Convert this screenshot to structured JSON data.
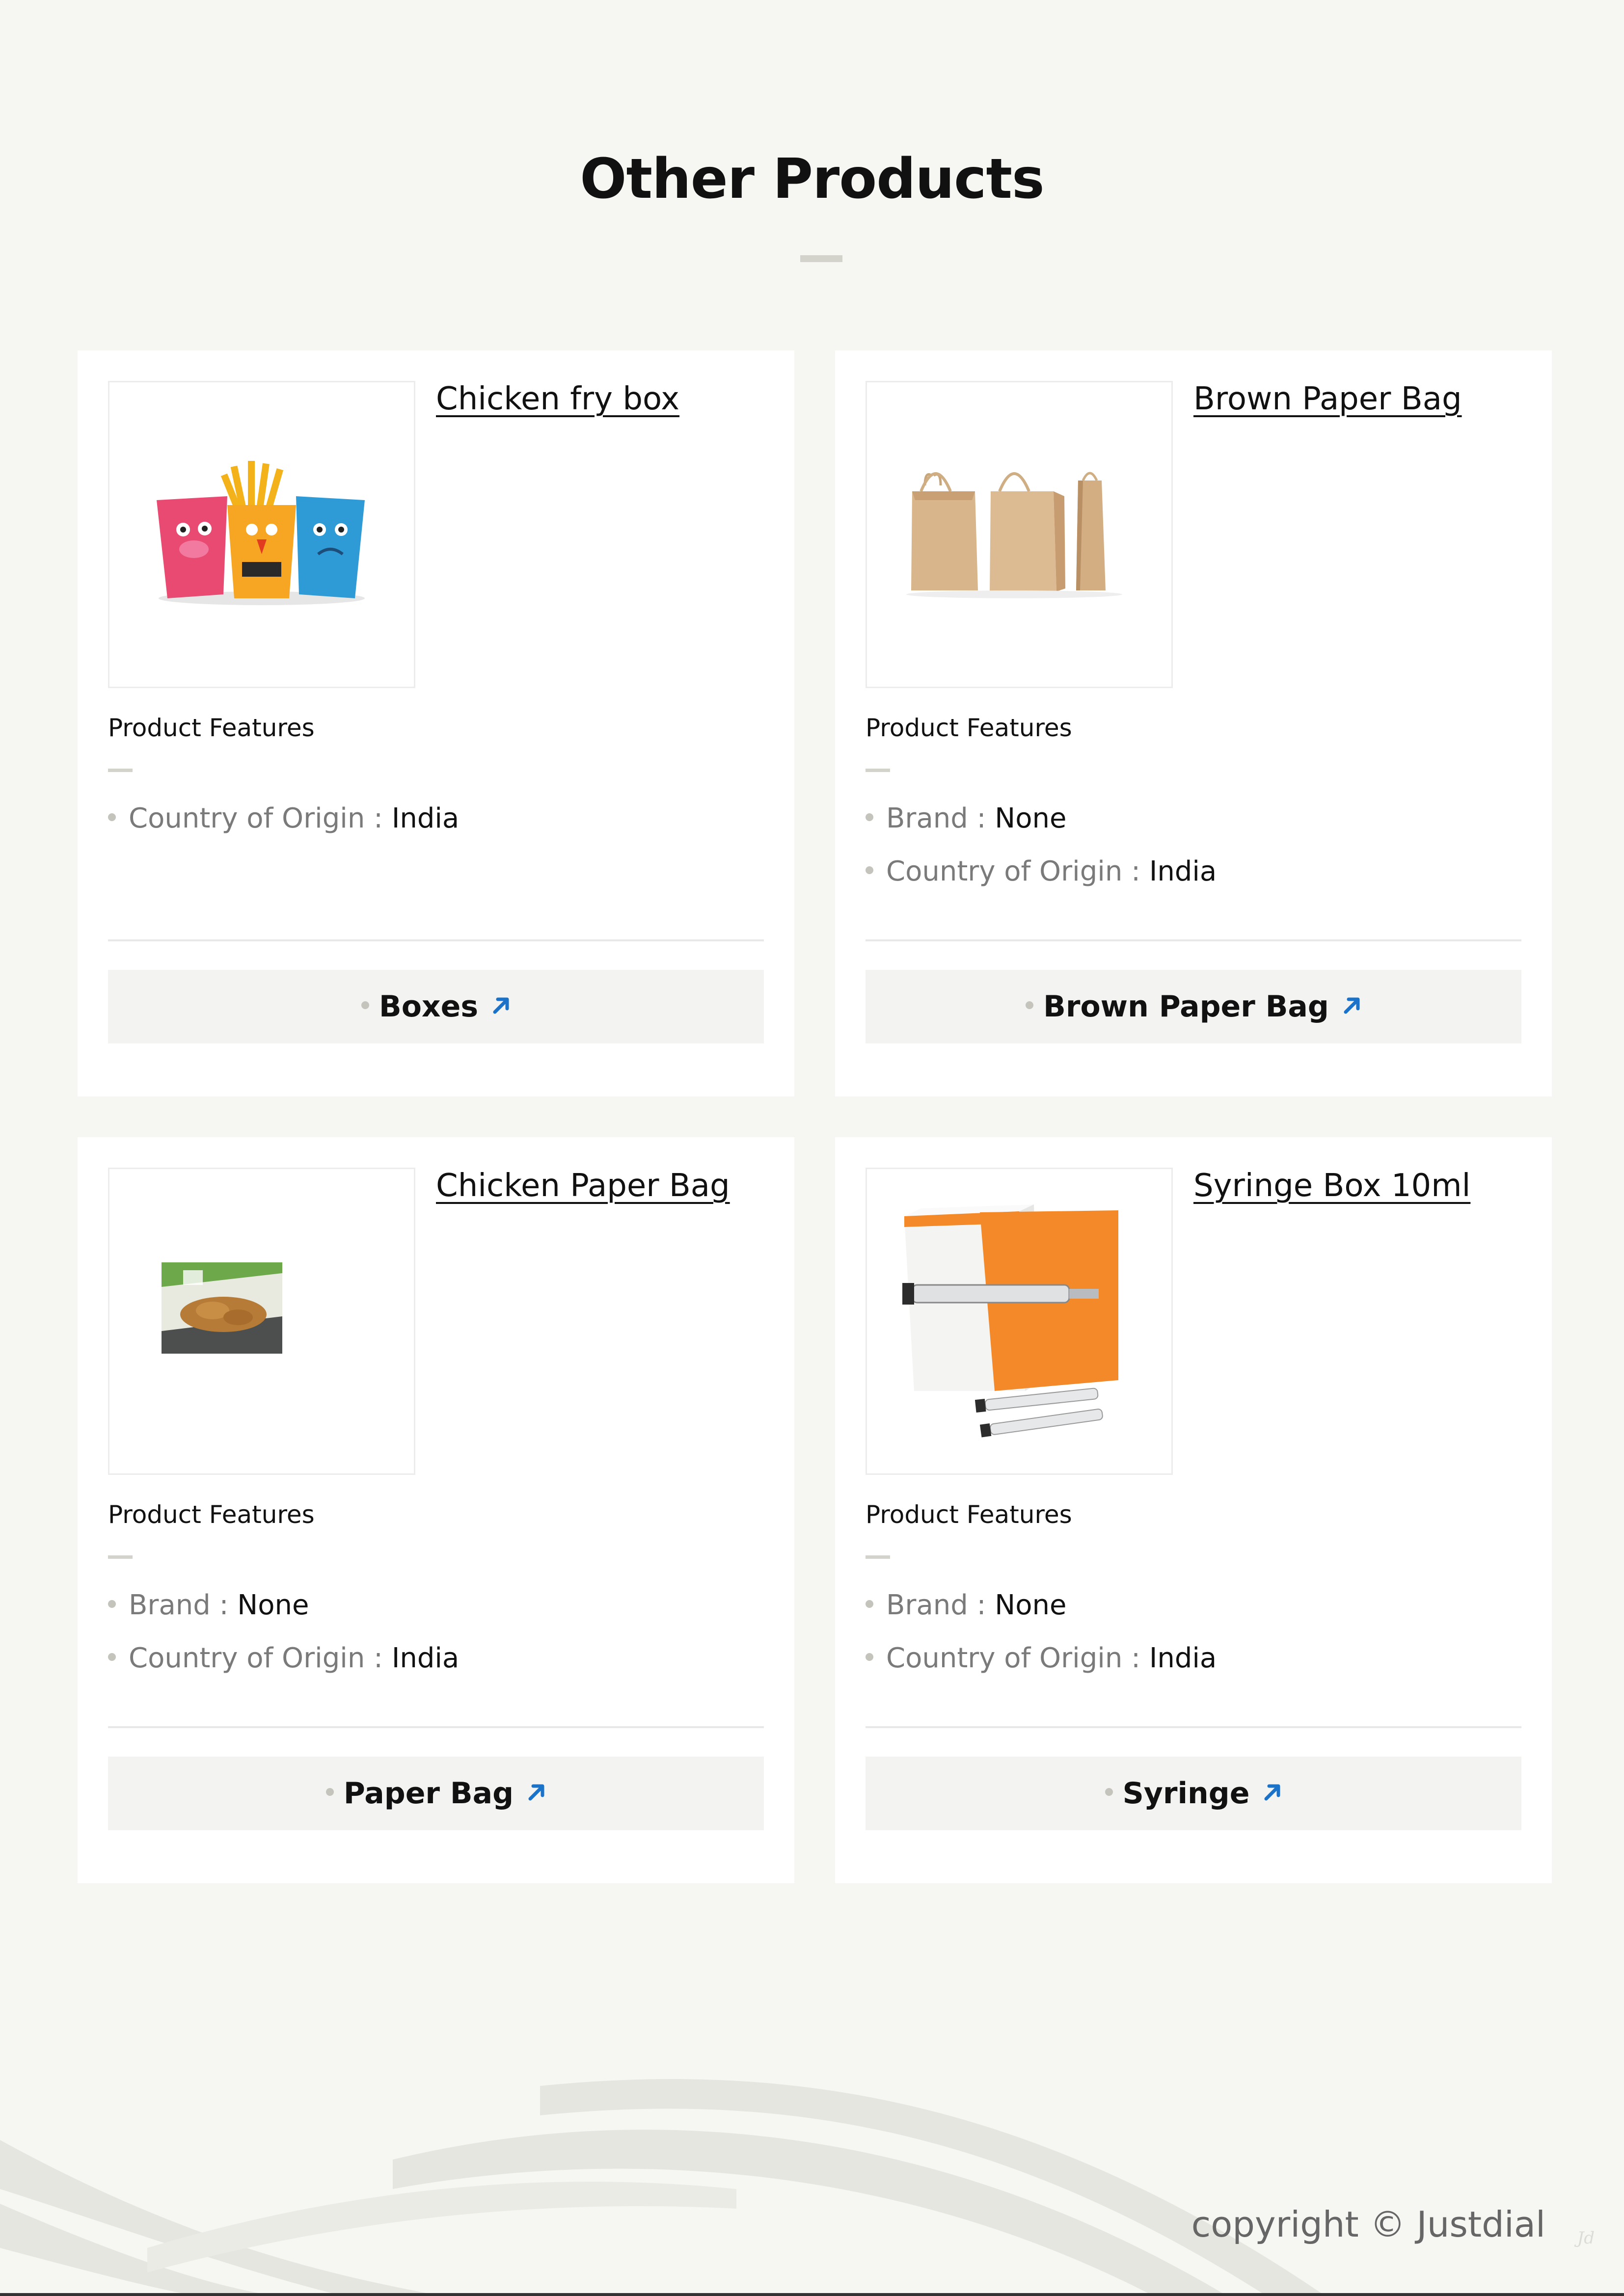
{
  "section": {
    "title": "Other Products"
  },
  "products": [
    {
      "name": "Chicken fry box",
      "image_icon": "chicken-fry-box-image",
      "features_title": "Product Features",
      "features": [
        {
          "key": "Country of Origin",
          "sep": ":",
          "value": "India"
        }
      ],
      "category_label": "Boxes"
    },
    {
      "name": "Brown Paper Bag",
      "image_icon": "brown-paper-bag-image",
      "features_title": "Product Features",
      "features": [
        {
          "key": "Brand",
          "sep": ":",
          "value": "None"
        },
        {
          "key": "Country of Origin",
          "sep": ":",
          "value": "India"
        }
      ],
      "category_label": "Brown Paper Bag"
    },
    {
      "name": "Chicken Paper Bag",
      "image_icon": "chicken-paper-bag-image",
      "features_title": "Product Features",
      "features": [
        {
          "key": "Brand",
          "sep": ":",
          "value": "None"
        },
        {
          "key": "Country of Origin",
          "sep": ":",
          "value": "India"
        }
      ],
      "category_label": "Paper Bag"
    },
    {
      "name": "Syringe Box 10ml",
      "image_icon": "syringe-box-image",
      "features_title": "Product Features",
      "features": [
        {
          "key": "Brand",
          "sep": ":",
          "value": "None"
        },
        {
          "key": "Country of Origin",
          "sep": ":",
          "value": "India"
        }
      ],
      "category_label": "Syringe"
    }
  ],
  "footer": {
    "copyright": "copyright © Justdial",
    "mark": "Jd"
  },
  "colors": {
    "accent_arrow": "#1a73c9",
    "background": "#f6f6f3",
    "card": "#ffffff"
  }
}
